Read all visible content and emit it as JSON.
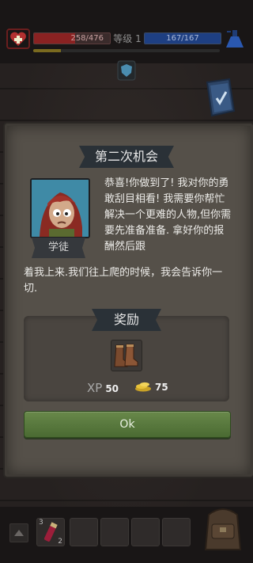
{
  "hud": {
    "hp_text": "258/476",
    "hp_fraction": 0.54,
    "level_label": "等级 1",
    "mp_text": "167/167",
    "mp_fraction": 1.0,
    "xp_fraction": 0.15,
    "heart_icon": "heart-plus-icon",
    "potion_icon": "blue-flask-icon",
    "shield_icon": "shield-badge-icon",
    "journal_icon": "quest-book-icon"
  },
  "dialog": {
    "title": "第二次机会",
    "npc_name": "学徒",
    "text_part1": "恭喜!你做到了! 我对你的勇敢刮目相看! 我需要你帮忙解决一个更难的人物,但你需要先准备准备. 拿好你的报酬然后跟",
    "text_part2": "着我上来.我们往上爬的时候，我会告诉你一切.",
    "portrait_icon": "red-haired-apprentice-portrait"
  },
  "rewards": {
    "title": "奖励",
    "item_icon": "leather-boots-icon",
    "xp_label": "XP",
    "xp_value": "50",
    "gold_icon": "gold-coins-icon",
    "gold_value": "75"
  },
  "ok_button": {
    "label": "Ok"
  },
  "inventory": {
    "slot1": {
      "icon": "red-potion-icon",
      "count_top": "3",
      "count_bottom": "2"
    },
    "backpack_icon": "backpack-icon",
    "up_icon": "up-arrow-icon"
  },
  "colors": {
    "hp": "#8a2222",
    "mp": "#1e3f82",
    "ok_button": "#5a7a3e",
    "panel": "#555049"
  }
}
